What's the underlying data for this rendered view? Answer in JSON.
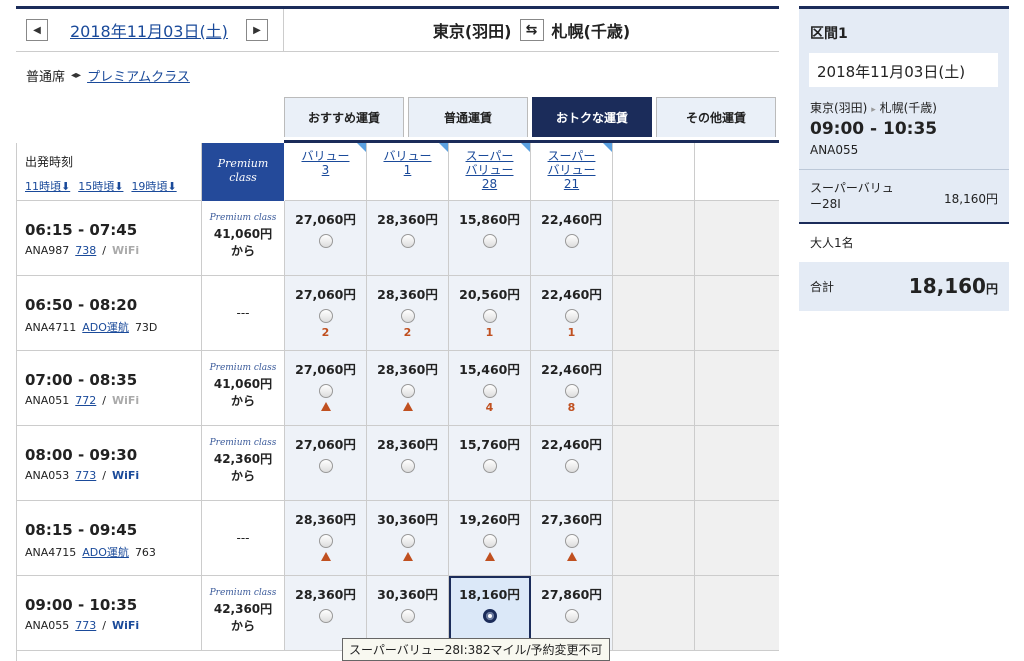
{
  "header": {
    "prev_label": "◀",
    "next_label": "▶",
    "date": "2018年11月03日(土)",
    "origin": "東京(羽田)",
    "swap_label": "⇆",
    "destination": "札幌(千歳)"
  },
  "cabin": {
    "current": "普通席",
    "switch_arrow": "◂▸",
    "alt": "プレミアムクラス"
  },
  "tabs": [
    "おすすめ運賃",
    "普通運賃",
    "おトクな運賃",
    "その他運賃"
  ],
  "active_tab": 2,
  "table_header": {
    "departure_label": "出発時刻",
    "sort_links": [
      "11時頃⬇",
      "15時頃⬇",
      "19時頃⬇"
    ],
    "premium_line1": "Premium",
    "premium_line2": "class",
    "fares": [
      {
        "l1": "バリュー",
        "l2": "3"
      },
      {
        "l1": "バリュー",
        "l2": "1"
      },
      {
        "l1": "スーパー",
        "l2": "バリュー",
        "l3": "28"
      },
      {
        "l1": "スーパー",
        "l2": "バリュー",
        "l3": "21"
      }
    ]
  },
  "flights": [
    {
      "time": "06:15 - 07:45",
      "no": "ANA987",
      "aircraft": "738",
      "wifi": "WiFi",
      "op": "",
      "prem_logo": "Premium class",
      "prem_price": "41,060円",
      "prem_from": "から",
      "fares": [
        {
          "p": "27,060円",
          "s": ""
        },
        {
          "p": "28,360円",
          "s": ""
        },
        {
          "p": "15,860円",
          "s": ""
        },
        {
          "p": "22,460円",
          "s": ""
        }
      ]
    },
    {
      "time": "06:50 - 08:20",
      "no": "ANA4711",
      "aircraft": "73D",
      "wifi": "",
      "op": "ADO運航",
      "prem_none": "---",
      "fares": [
        {
          "p": "27,060円",
          "s": "2"
        },
        {
          "p": "28,360円",
          "s": "2"
        },
        {
          "p": "20,560円",
          "s": "1"
        },
        {
          "p": "22,460円",
          "s": "1"
        }
      ]
    },
    {
      "time": "07:00 - 08:35",
      "no": "ANA051",
      "aircraft": "772",
      "wifi": "WiFi",
      "op": "",
      "prem_logo": "Premium class",
      "prem_price": "41,060円",
      "prem_from": "から",
      "fares": [
        {
          "p": "27,060円",
          "s": "▲"
        },
        {
          "p": "28,360円",
          "s": "▲"
        },
        {
          "p": "15,460円",
          "s": "4"
        },
        {
          "p": "22,460円",
          "s": "8"
        }
      ]
    },
    {
      "time": "08:00 - 09:30",
      "no": "ANA053",
      "aircraft": "773",
      "wifi": "WiFi",
      "op": "",
      "prem_logo": "Premium class",
      "prem_price": "42,360円",
      "prem_from": "から",
      "fares": [
        {
          "p": "27,060円",
          "s": ""
        },
        {
          "p": "28,360円",
          "s": ""
        },
        {
          "p": "15,760円",
          "s": ""
        },
        {
          "p": "22,460円",
          "s": ""
        }
      ]
    },
    {
      "time": "08:15 - 09:45",
      "no": "ANA4715",
      "aircraft": "763",
      "wifi": "",
      "op": "ADO運航",
      "prem_none": "---",
      "fares": [
        {
          "p": "28,360円",
          "s": "▲"
        },
        {
          "p": "30,360円",
          "s": "▲"
        },
        {
          "p": "19,260円",
          "s": "▲"
        },
        {
          "p": "27,360円",
          "s": "▲"
        }
      ]
    },
    {
      "time": "09:00 - 10:35",
      "no": "ANA055",
      "aircraft": "773",
      "wifi": "WiFi",
      "op": "",
      "prem_logo": "Premium class",
      "prem_price": "42,360円",
      "prem_from": "から",
      "fares": [
        {
          "p": "28,360円",
          "s": ""
        },
        {
          "p": "30,360円",
          "s": ""
        },
        {
          "p": "18,160円",
          "s": ""
        },
        {
          "p": "27,860円",
          "s": ""
        }
      ]
    }
  ],
  "tooltip": "スーパーバリュー28I:382マイル/予約変更不可",
  "sidebar": {
    "section": "区間1",
    "date": "2018年11月03日(土)",
    "origin": "東京(羽田)",
    "route_sep": "▸",
    "destination": "札幌(千歳)",
    "time": "09:00 - 10:35",
    "flight_no": "ANA055",
    "fare_name": "スーパーバリュー28I",
    "fare_price": "18,160円",
    "pax": "大人1名",
    "total_label": "合計",
    "total_value": "18,160",
    "total_unit": "円"
  },
  "colors": {
    "navy": "#1b2c5a",
    "link": "#1a4a9a",
    "seat": "#c05020"
  }
}
